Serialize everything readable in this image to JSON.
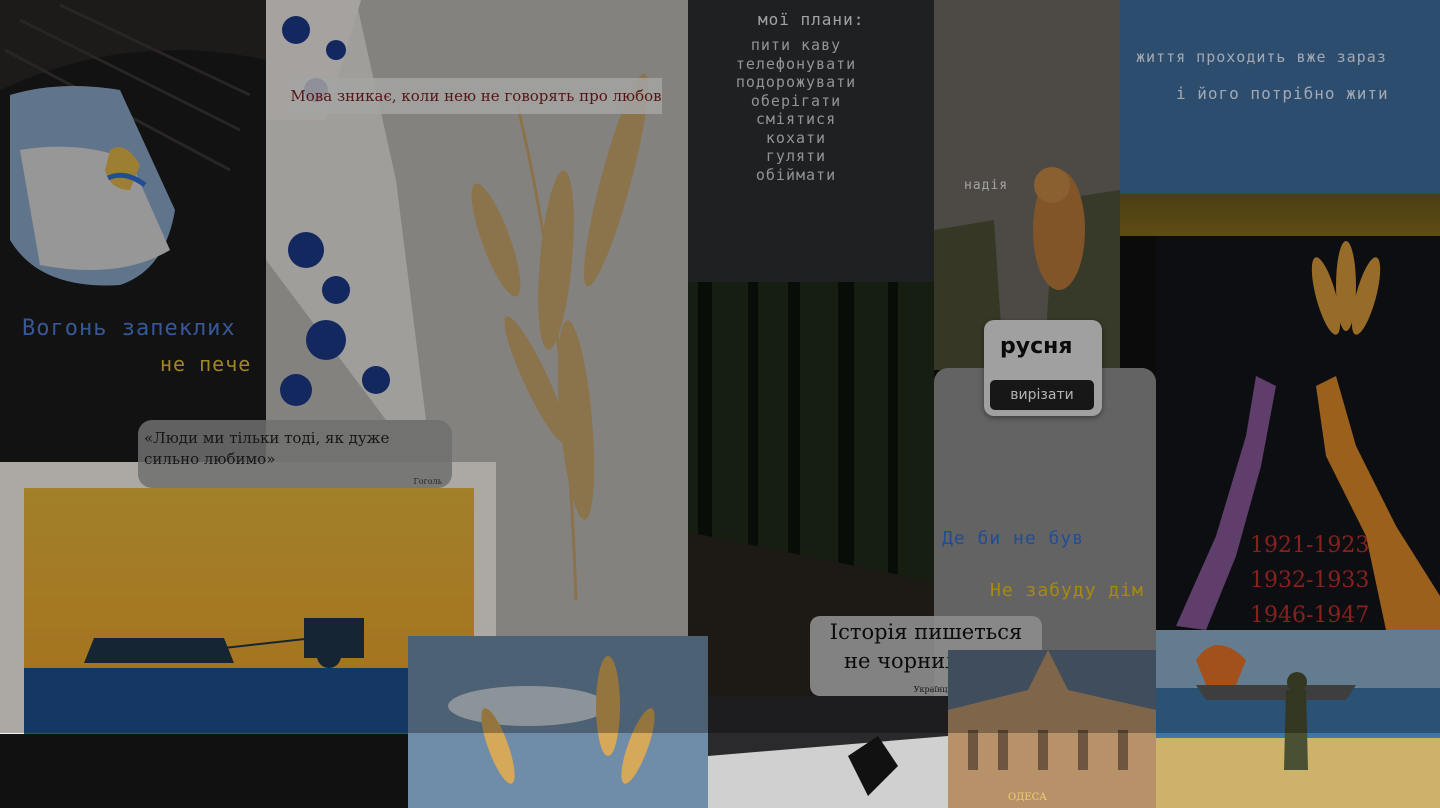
{
  "tiles": {
    "fire_poster": {
      "line1": "Вогонь запеклих",
      "line2": "не пече"
    },
    "linen": {
      "quote": "Мова зникає, коли нею не говорять про любов"
    },
    "plans": {
      "title": "мої плани:",
      "items": [
        "пити каву",
        "телефонувати",
        "подорожувати",
        "оберігати",
        "сміятися",
        "кохати",
        "гуляти",
        "обіймати"
      ]
    },
    "cat": {
      "label": "надія"
    },
    "sky_poster": {
      "line1": "життя проходить вже зараз",
      "line2": "і його потрібно жити"
    },
    "quote_love": {
      "text": "«Люди ми тільки тоді, як дуже сильно любимо»",
      "author": "Гоголь"
    },
    "copy_popup": {
      "word": "русня",
      "action": "вирізати"
    },
    "home": {
      "line1": "Де би не був",
      "line2": "Не забуду дім"
    },
    "famine": {
      "years": [
        "1921-1923",
        "1932-1933",
        "1946-1947"
      ]
    },
    "history": {
      "text": "Історія пишеться не чорнилами.",
      "author": "Українці"
    },
    "opera": {
      "caption": "ОДЕСА"
    }
  },
  "colors": {
    "ukraine_blue": "#2f6fd6",
    "ukraine_yellow": "#f0c419",
    "famine_red": "#c0302a",
    "sky_text": "#e8f0ff"
  }
}
